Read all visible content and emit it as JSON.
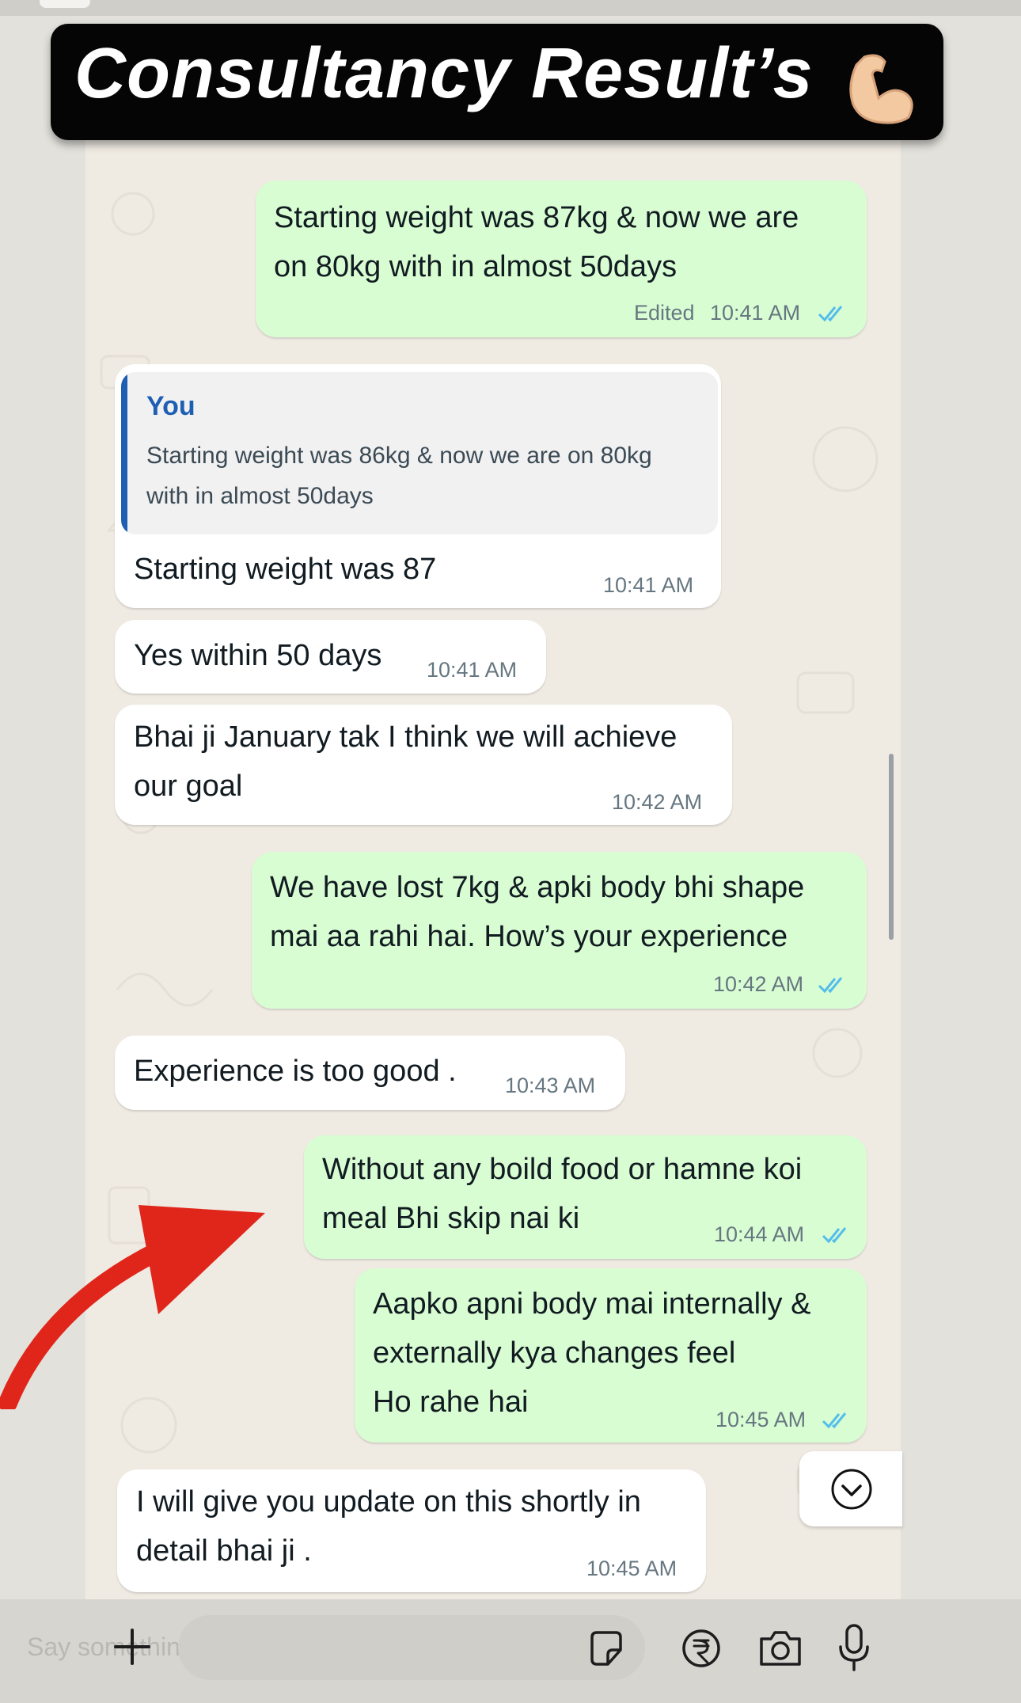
{
  "banner": {
    "title": "Consultancy Result’s"
  },
  "messages": [
    {
      "text": "Starting weight was 87kg & now we are\non 80kg with in almost 50days",
      "edited": "Edited",
      "time": "10:41 AM"
    },
    {
      "quote_author": "You",
      "quote_text": "Starting weight was 86kg & now we are on 80kg with in almost 50days",
      "text": "Starting weight was 87",
      "time": "10:41 AM"
    },
    {
      "text": "Yes within 50 days",
      "time": "10:41 AM"
    },
    {
      "text": "Bhai ji January tak I think we will achieve\nour goal",
      "time": "10:42 AM"
    },
    {
      "text": "We have lost 7kg & apki body bhi shape\nmai aa rahi hai. How’s your experience",
      "time": "10:42 AM"
    },
    {
      "text": "Experience is too good .",
      "time": "10:43 AM"
    },
    {
      "text": "Without any boild food or hamne koi\nmeal Bhi skip nai ki",
      "time": "10:44 AM"
    },
    {
      "text": "Aapko apni body mai internally &\nexternally kya changes feel\nHo rahe hai",
      "time": "10:45 AM"
    },
    {
      "text": "I will give you update on this shortly in\ndetail bhai ji .",
      "time": "10:45 AM"
    }
  ],
  "composer": {
    "placeholder": "Say something..."
  },
  "icons": [
    "flexed-biceps-icon",
    "double-check-icon",
    "scroll-down-icon",
    "plus-icon",
    "sticker-icon",
    "rupee-icon",
    "camera-icon",
    "microphone-icon",
    "red-arrow-icon"
  ],
  "colors": {
    "outgoing": "#d9fdd3",
    "incoming": "#ffffff",
    "read_ticks": "#53bdeb",
    "quote_accent": "#1f5fb3",
    "arrow": "#e0261b"
  }
}
